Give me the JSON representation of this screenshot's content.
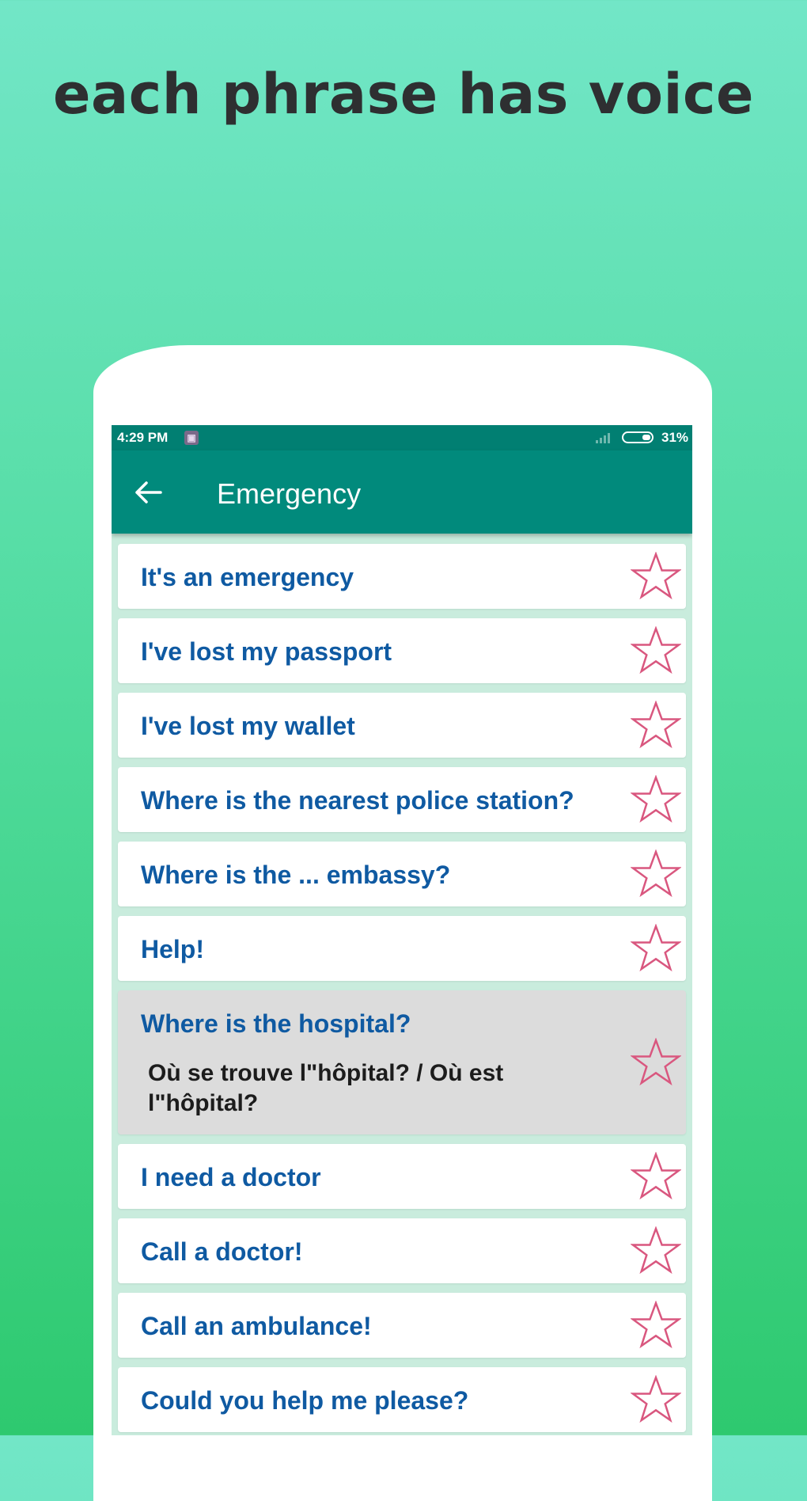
{
  "promo": {
    "headline": "each phrase has voice"
  },
  "statusbar": {
    "time": "4:29 PM",
    "battery": "31%"
  },
  "toolbar": {
    "title": "Emergency"
  },
  "phrases": [
    {
      "text": "It's an emergency"
    },
    {
      "text": "I've lost my passport"
    },
    {
      "text": "I've lost my wallet"
    },
    {
      "text": "Where is the nearest police station?"
    },
    {
      "text": "Where is the ... embassy?"
    },
    {
      "text": "Help!"
    },
    {
      "text": "Where is the hospital?",
      "translation": "Où se trouve l\"hôpital? / Où est l\"hôpital?"
    },
    {
      "text": "I need a doctor"
    },
    {
      "text": "Call a doctor!"
    },
    {
      "text": "Call an ambulance!"
    },
    {
      "text": "Could you help me please?"
    }
  ],
  "colors": {
    "toolbar": "#018a7c",
    "statusbar": "#017f72",
    "phrase": "#0f5aa2",
    "star": "#d9577f",
    "expanded_card": "#dcdcdc"
  },
  "icons": {
    "back": "arrow-left-icon",
    "favorite": "star-outline-icon"
  }
}
